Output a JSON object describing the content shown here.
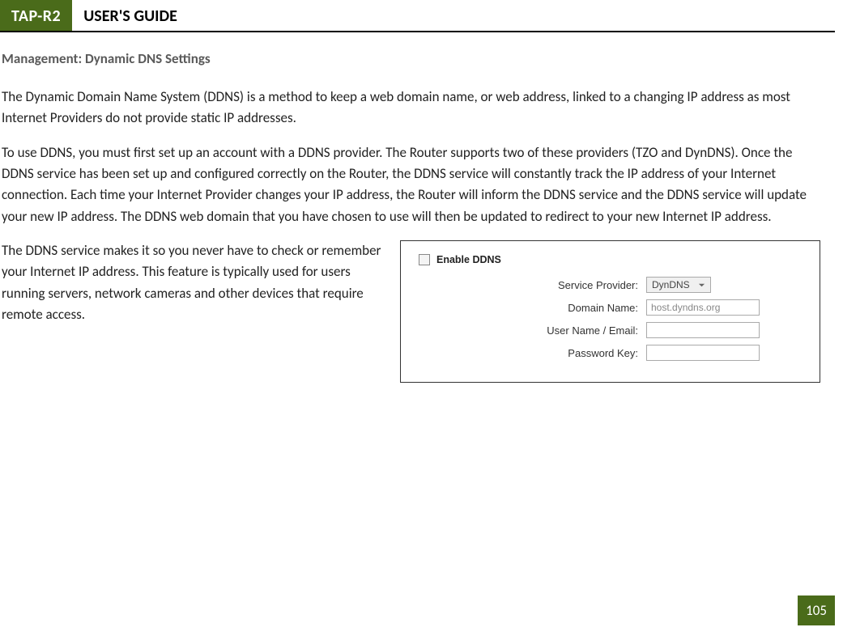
{
  "header": {
    "badge": "TAP-R2",
    "title": "USER'S GUIDE"
  },
  "section_heading": "Management: Dynamic DNS Settings",
  "paragraphs": {
    "p1": "The Dynamic Domain Name System (DDNS) is a method to keep a web domain name, or web address, linked to a changing IP address as most Internet Providers do not provide static IP addresses.",
    "p2": "To use DDNS, you must first set up an account with a DDNS provider. The Router supports two of these providers (TZO and DynDNS). Once the DDNS service has been set up and configured correctly on the Router, the DDNS service will constantly track the IP address of your Internet connection. Each time your Internet Provider changes your IP address, the Router will inform the DDNS service and the DDNS service will update your new IP address.  The DDNS web domain that you have chosen to use will then be updated to redirect to your new Internet IP address.",
    "p3": "The DDNS service makes it so you never have to check or remember your Internet IP address. This feature is typically used for users running servers, network cameras and other devices that require remote access."
  },
  "panel": {
    "enable_label": "Enable DDNS",
    "rows": {
      "service_provider": {
        "label": "Service Provider:",
        "value": "DynDNS"
      },
      "domain_name": {
        "label": "Domain Name:",
        "value": "host.dyndns.org"
      },
      "user_name": {
        "label": "User Name / Email:",
        "value": ""
      },
      "password": {
        "label": "Password Key:",
        "value": ""
      }
    }
  },
  "page_number": "105"
}
